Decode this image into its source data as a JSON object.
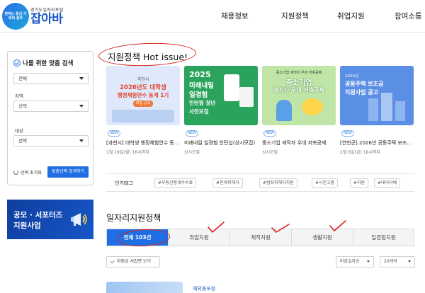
{
  "header": {
    "logo_badge": "편하는 중심 기회의 광주",
    "logo_sub": "경기도일자리포털",
    "logo_main": "잡아바",
    "nav": [
      "채용정보",
      "지원정책",
      "취업지원",
      "참여소통"
    ]
  },
  "filter": {
    "title": "나를 위한 맞춤 검색",
    "select1": "전체",
    "region_label": "지역",
    "region_value": "선택",
    "target_label": "대상",
    "target_value": "선택",
    "reset_label": "선택 초기화",
    "search_label": "맞춤선택 검색하기"
  },
  "banner": {
    "line1": "공모 · 서포터즈",
    "line2": "지원사업"
  },
  "hot": {
    "title": "지원정책 Hot issue!",
    "cards": [
      {
        "img_lines": [
          "과천시",
          "2026년도 대학생",
          "행정체험연수 동계 1기",
          "모집 공고"
        ],
        "badge": "NEW",
        "title": "[과천시] 대학생 행정체험연수 동...",
        "meta": "1월 19일(월) 16시까지"
      },
      {
        "img_lines": [
          "2025",
          "미래내일",
          "일경험",
          "인턴형 청년",
          "사전모집"
        ],
        "badge": "NEW",
        "title": "미래내일 일경험 인턴십(상시모집)",
        "meta": "상시모집"
      },
      {
        "img_lines": [
          "중소기업 재직자 우대 저축공제",
          "중소기업",
          "재직자 우대 저축공제"
        ],
        "badge": "NEW",
        "title": "중소기업 재직자 우대 저축공제",
        "meta": "상시모집"
      },
      {
        "img_lines": [
          "2026년",
          "공동주택 보조금",
          "지원사업 공고"
        ],
        "badge": "NEW",
        "title": "[연천군] 2026년 공동주택 보조금...",
        "meta": "2월 6일(금) 18시까지"
      }
    ]
  },
  "tags": {
    "label": "인기태그",
    "items": [
      "#부동산중개수수료",
      "#전세피해자",
      "#범죄피해자지원",
      "#시민고충",
      "#지원",
      "#데이터베"
    ]
  },
  "jobs": {
    "title": "일자리지원정책",
    "tabs": [
      "전체 103건",
      "취업지원",
      "재직지원",
      "생활지원",
      "일경험지원"
    ],
    "subscribe_label": "지원금 서랍면 보기",
    "sort1": "마감일자순",
    "sort2": "20개씩",
    "first_item": "재외동포청"
  },
  "colors": {
    "accent": "#1f6ee3",
    "annotation": "#d6221b"
  }
}
